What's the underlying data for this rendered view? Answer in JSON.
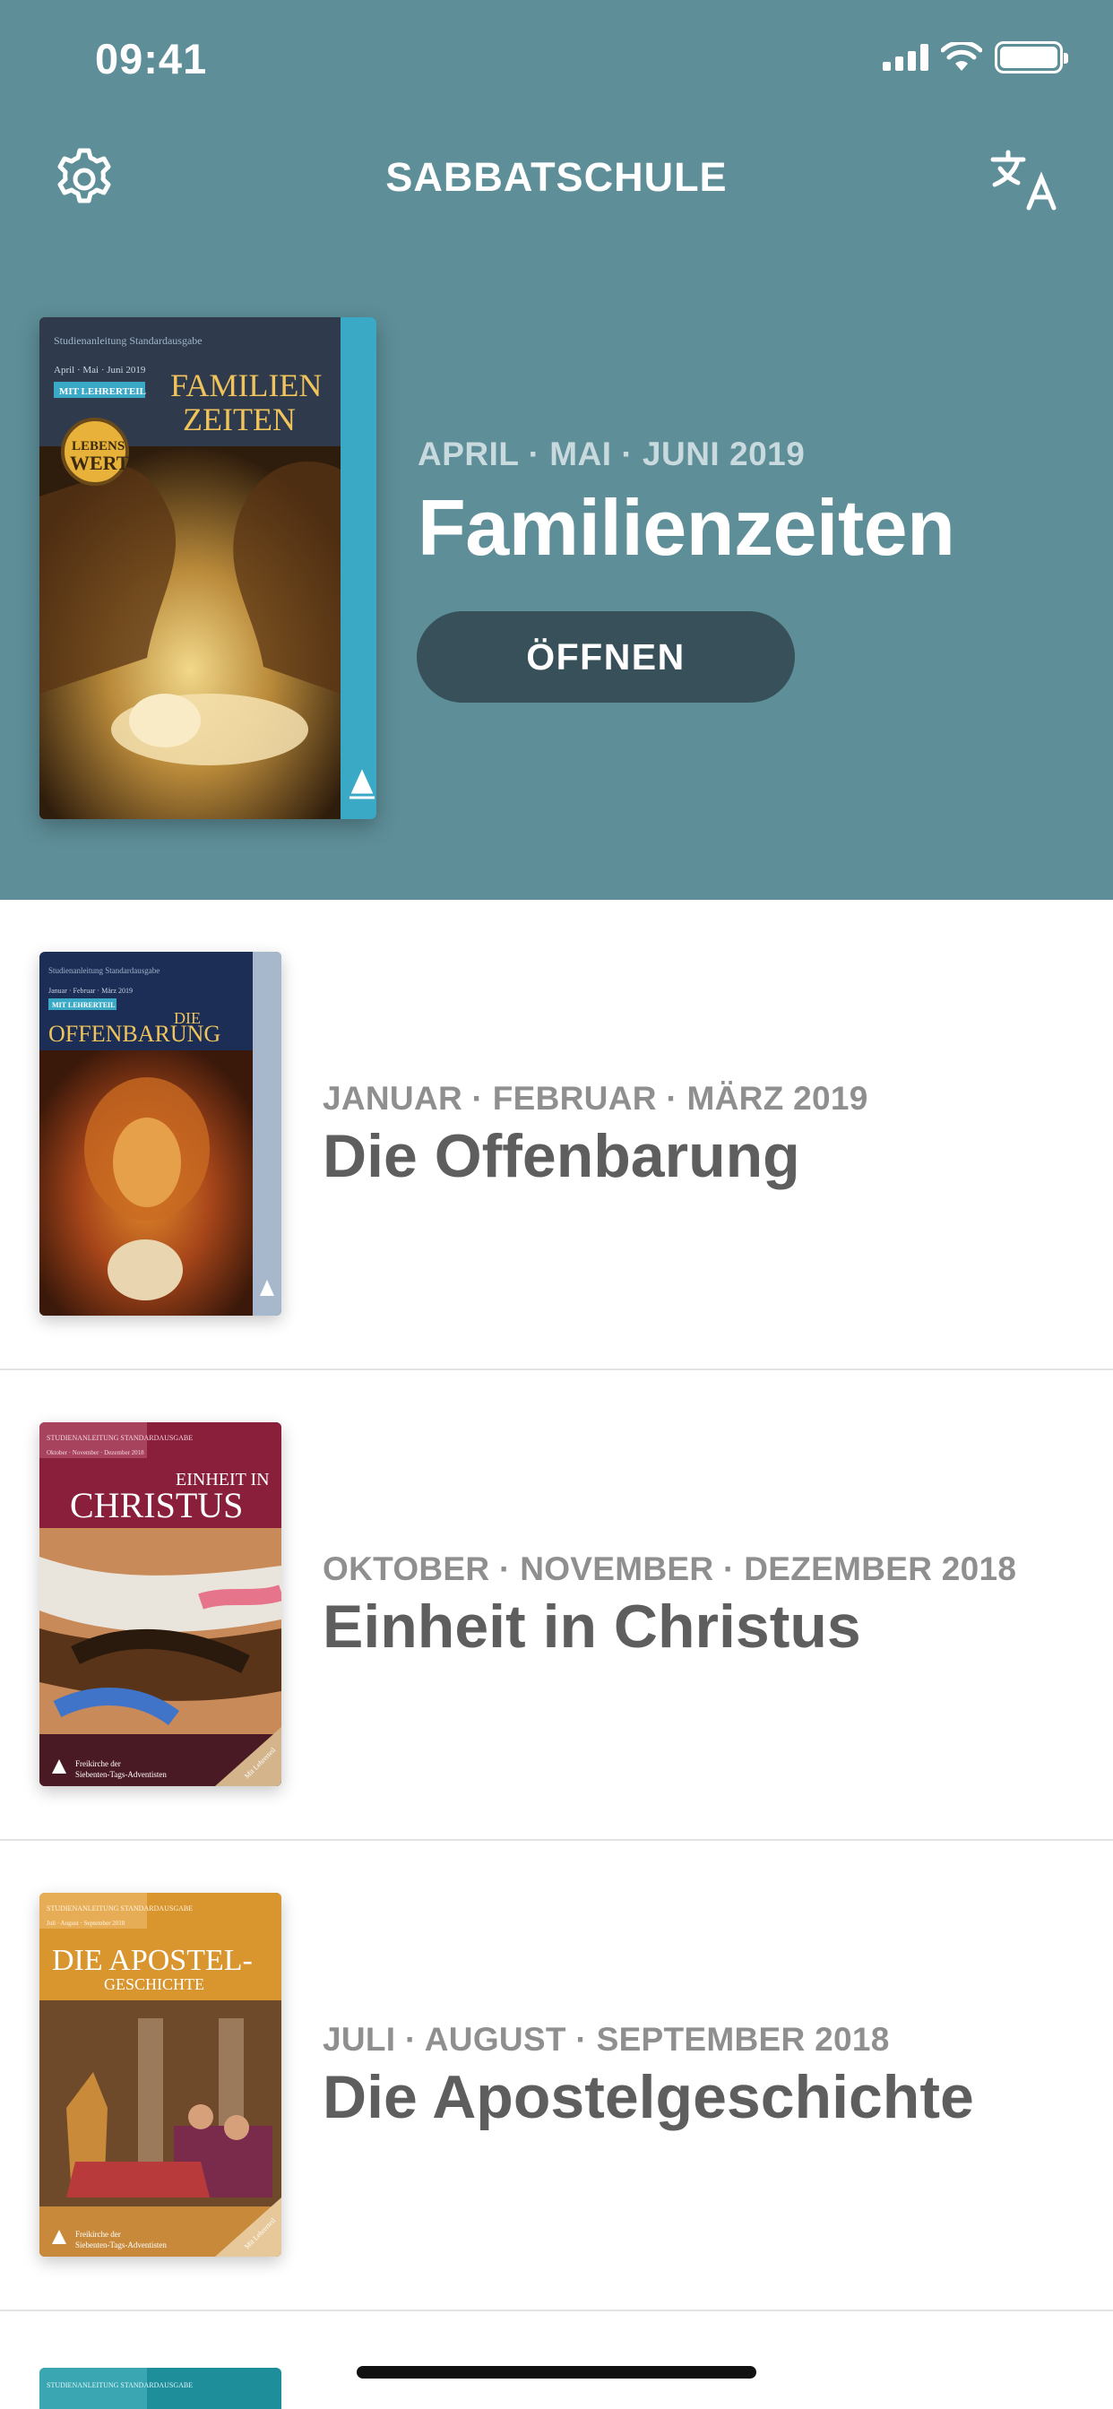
{
  "status_bar": {
    "time": "09:41"
  },
  "nav": {
    "title": "SABBATSCHULE"
  },
  "icons": {
    "settings": "gear-icon",
    "language": "translate-icon"
  },
  "featured": {
    "dates": "APRIL · MAI · JUNI 2019",
    "title": "Familienzeiten",
    "open_label": "ÖFFNEN",
    "cover": {
      "kicker": "Studienanleitung Standardausgabe",
      "period": "April · Mai · Juni 2019",
      "badge": "MIT LEHRERTEIL",
      "title_line1": "FAMILIEN",
      "title_line2": "ZEITEN",
      "seal_line1": "LEBENS",
      "seal_line2": "WERT"
    }
  },
  "lessons": [
    {
      "dates": "JANUAR · FEBRUAR · MÄRZ 2019",
      "title": "Die Offenbarung",
      "cover": {
        "kicker": "Studienanleitung Standardausgabe",
        "period": "Januar · Februar · März 2019",
        "badge": "MIT LEHRERTEIL",
        "title_line1": "DIE",
        "title_line2": "OFFENBARUNG"
      }
    },
    {
      "dates": "OKTOBER · NOVEMBER · DEZEMBER 2018",
      "title": "Einheit in Christus",
      "cover": {
        "kicker": "STUDIENANLEITUNG STANDARDAUSGABE",
        "period": "Oktober · November · Dezember 2018",
        "title_line1": "EINHEIT IN",
        "title_line2": "CHRISTUS",
        "footer_line1": "Freikirche der",
        "footer_line2": "Siebenten-Tags-Adventisten",
        "corner": "Mit Lehrerteil"
      }
    },
    {
      "dates": "JULI · AUGUST · SEPTEMBER 2018",
      "title": "Die Apostelgeschichte",
      "cover": {
        "kicker": "STUDIENANLEITUNG STANDARDAUSGABE",
        "period": "Juli · August · September 2018",
        "title_line1": "DIE APOSTEL-",
        "title_line2": "GESCHICHTE",
        "footer_line1": "Freikirche der",
        "footer_line2": "Siebenten-Tags-Adventisten",
        "corner": "Mit Lehrerteil"
      }
    }
  ],
  "peek_cover": {
    "kicker": "STUDIENANLEITUNG STANDARDAUSGABE"
  }
}
